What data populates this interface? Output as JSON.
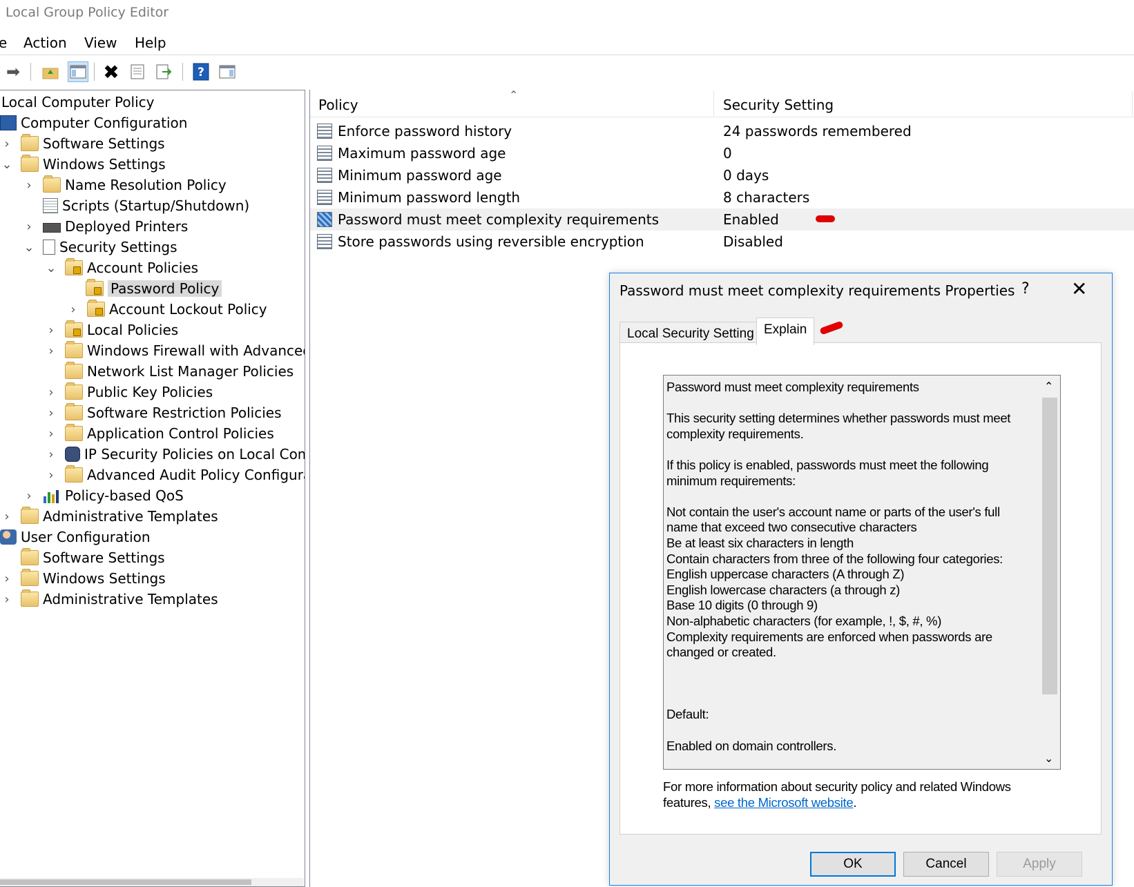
{
  "window": {
    "title": "Local Group Policy Editor"
  },
  "menu": {
    "items": [
      "e",
      "Action",
      "View",
      "Help"
    ]
  },
  "toolbar": {
    "icons": [
      "forward-icon",
      "up-folder-icon",
      "show-tree-icon",
      "delete-icon",
      "properties-icon",
      "export-list-icon",
      "help-icon",
      "show-action-pane-icon"
    ]
  },
  "tree": {
    "root": "Local Computer Policy",
    "computer_configuration": "Computer Configuration",
    "cc_software_settings": "Software Settings",
    "cc_windows_settings": "Windows Settings",
    "name_resolution_policy": "Name Resolution Policy",
    "scripts": "Scripts (Startup/Shutdown)",
    "deployed_printers": "Deployed Printers",
    "security_settings": "Security Settings",
    "account_policies": "Account Policies",
    "password_policy": "Password Policy",
    "account_lockout_policy": "Account Lockout Policy",
    "local_policies": "Local Policies",
    "windows_firewall": "Windows Firewall with Advanced S",
    "network_list_manager": "Network List Manager Policies",
    "public_key_policies": "Public Key Policies",
    "software_restriction": "Software Restriction Policies",
    "application_control": "Application Control Policies",
    "ip_security": "IP Security Policies on Local Compu",
    "advanced_audit": "Advanced Audit Policy Configurati",
    "policy_qos": "Policy-based QoS",
    "cc_admin_templates": "Administrative Templates",
    "user_configuration": "User Configuration",
    "uc_software_settings": "Software Settings",
    "uc_windows_settings": "Windows Settings",
    "uc_admin_templates": "Administrative Templates"
  },
  "list": {
    "columns": {
      "policy": "Policy",
      "setting": "Security Setting"
    },
    "rows": [
      {
        "policy": "Enforce password history",
        "setting": "24 passwords remembered"
      },
      {
        "policy": "Maximum password age",
        "setting": "0"
      },
      {
        "policy": "Minimum password age",
        "setting": "0 days"
      },
      {
        "policy": "Minimum password length",
        "setting": "8 characters"
      },
      {
        "policy": "Password must meet complexity requirements",
        "setting": "Enabled"
      },
      {
        "policy": "Store passwords using reversible encryption",
        "setting": "Disabled"
      }
    ]
  },
  "dialog": {
    "title": "Password must meet complexity requirements Properties",
    "help": "?",
    "close": "✕",
    "tabs": [
      "Local Security Setting",
      "Explain"
    ],
    "explain_text": "Password must meet complexity requirements\n\nThis security setting determines whether passwords must meet\ncomplexity requirements.\n\nIf this policy is enabled, passwords must meet the following\nminimum requirements:\n\nNot contain the user's account name or parts of the user's full\nname that exceed two consecutive characters\nBe at least six characters in length\nContain characters from three of the following four categories:\nEnglish uppercase characters (A through Z)\nEnglish lowercase characters (a through z)\nBase 10 digits (0 through 9)\nNon-alphabetic characters (for example, !, $, #, %)\nComplexity requirements are enforced when passwords are\nchanged or created.\n\n\n\nDefault:\n\nEnabled on domain controllers.",
    "more_info_prefix": "For more information about security policy and related Windows features, ",
    "more_info_link": "see the Microsoft website",
    "more_info_suffix": ".",
    "buttons": {
      "ok": "OK",
      "cancel": "Cancel",
      "apply": "Apply"
    }
  },
  "colors": {
    "accent": "#1a82e2",
    "link": "#0066cc",
    "annotation": "#e00000"
  }
}
